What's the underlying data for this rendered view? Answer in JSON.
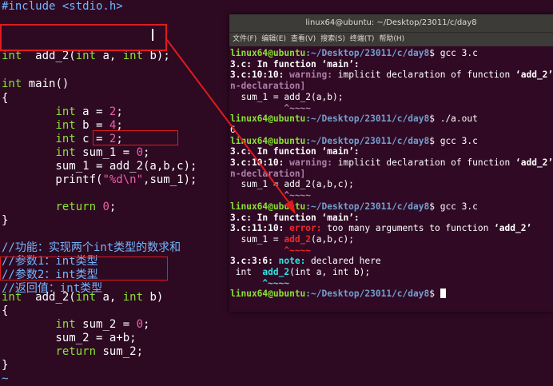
{
  "editor": {
    "lines": [
      "#include <stdio.h>",
      "",
      "int  add_2(int a, int b);",
      "",
      "int main()",
      "{",
      "        int a = 2;",
      "        int b = 4;",
      "        int c = 2;",
      "        int sum_1 = 0;",
      "        sum_1 = add_2(a,b,c);",
      "        printf(\"%d\\n\",sum_1);",
      "",
      "        return 0;",
      "}",
      "",
      "//功能：实现两个int类型的数求和",
      "//参数1：int类型",
      "//参数2：int类型",
      "//返回值：int类型",
      "int  add_2(int a, int b)",
      "{",
      "        int sum_2 = 0;",
      "        sum_2 = a+b;",
      "        return sum_2;",
      "}",
      "~"
    ],
    "colors": {
      "keyword": "#8ae234",
      "number": "#ef5fa8",
      "comment": "#75b5ff",
      "highlight_box": "#e01b1b"
    }
  },
  "terminal": {
    "title": "linux64@ubuntu: ~/Desktop/23011/c/day8",
    "menu": [
      "文件(F)",
      "编辑(E)",
      "查看(V)",
      "搜索(S)",
      "终端(T)",
      "帮助(H)"
    ],
    "prompt_user": "linux64@ubuntu",
    "prompt_path": ":~/Desktop/23011/c/day8",
    "lines": [
      {
        "k": "prompt",
        "cmd": "gcc 3.c"
      },
      {
        "k": "text",
        "t": "3.c: In function ‘main’:"
      },
      {
        "k": "warn",
        "loc": "3.c:10:10: ",
        "label": "warning:",
        "msg": " implicit declaration of function ‘add_2’ [-W"
      },
      {
        "k": "tag",
        "t": "n-declaration]"
      },
      {
        "k": "plain",
        "t": "  sum_1 = add_2(a,b);"
      },
      {
        "k": "caret",
        "t": "          ^~~~~"
      },
      {
        "k": "prompt",
        "cmd": "./a.out"
      },
      {
        "k": "plain",
        "t": "6"
      },
      {
        "k": "prompt",
        "cmd": "gcc 3.c"
      },
      {
        "k": "text",
        "t": "3.c: In function ‘main’:"
      },
      {
        "k": "warn",
        "loc": "3.c:10:10: ",
        "label": "warning:",
        "msg": " implicit declaration of function ‘add_2’ [-W"
      },
      {
        "k": "tag",
        "t": "n-declaration]"
      },
      {
        "k": "plain",
        "t": "  sum_1 = add_2(a,b,c);"
      },
      {
        "k": "caret",
        "t": "          ^~~~~"
      },
      {
        "k": "prompt",
        "cmd": "gcc 3.c"
      },
      {
        "k": "text",
        "t": "3.c: In function ‘main’:"
      },
      {
        "k": "err",
        "loc": "3.c:11:10: ",
        "label": "error:",
        "msg": " too many arguments to function ‘add_2’"
      },
      {
        "k": "errcode",
        "pre": "  sum_1 = ",
        "hl": "add_2",
        "post": "(a,b,c);"
      },
      {
        "k": "caretr",
        "t": "          ^~~~~"
      },
      {
        "k": "note",
        "loc": "3.c:3:6: ",
        "label": "note:",
        "msg": " declared here"
      },
      {
        "k": "notecode",
        "pre": " int  ",
        "hl": "add_2",
        "post": "(int a, int b);"
      },
      {
        "k": "caretg",
        "t": "      ^~~~~"
      },
      {
        "k": "promptcur",
        "cmd": ""
      }
    ]
  }
}
